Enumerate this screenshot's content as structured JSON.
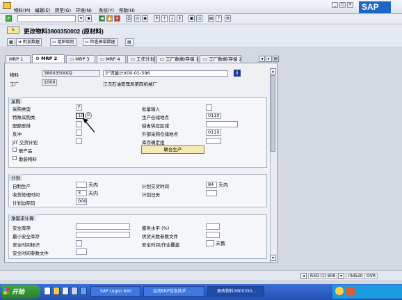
{
  "menu": {
    "items": [
      "物料(M)",
      "编辑(E)",
      "转至(G)",
      "环境(N)",
      "系统(Y)",
      "帮助(H)"
    ],
    "logo": "SAP"
  },
  "toolbar": {
    "command_value": ""
  },
  "title": "更改物料3800350002 (原材料)",
  "app_toolbar": {
    "additional_data": "附加数据",
    "org_levels": "组织级别",
    "check_screen_data": "检查屏幕数据"
  },
  "tabs": [
    "MRP 1",
    "MRP 2",
    "MRP 3",
    "MRP 4",
    "工作计划",
    "工厂数据/存储 1",
    "工厂数据/存储 2"
  ],
  "header": {
    "material_label": "物料",
    "material_value": "3800350002",
    "material_desc": "3\"流量计X00-01-596",
    "plant_label": "工厂",
    "plant_value": "1000",
    "plant_desc": "江汉石油管理局第四机械厂"
  },
  "procurement": {
    "title": "采购",
    "proc_type_label": "采购类型",
    "proc_type_value": "F",
    "special_proc_label": "特殊采购类",
    "special_proc_value": "10",
    "qt_label": "配额安排",
    "backflush_label": "反冲",
    "jit_label": "JIT 交货计划",
    "coproduct_label": "联产品",
    "bulk_label": "散装物料",
    "batch_entry_label": "批量输入",
    "prod_stor_label": "生产仓储地点",
    "prod_stor_value": "0110",
    "default_supply_label": "缺省供应区域",
    "ext_proc_stor_label": "外部采购仓储地点",
    "ext_proc_stor_value": "0110",
    "stor_bin_label": "库存确定组",
    "joint_prod_button": "联合生产"
  },
  "scheduling": {
    "title": "计划",
    "inhouse_label": "自制生产",
    "inhouse_unit": "天内",
    "gr_time_label": "收货处理时间",
    "gr_time_value": "3",
    "gr_time_unit": "天内",
    "sm_key_label": "计划边际码",
    "sm_key_value": "000",
    "pdt_label": "计划交货时间",
    "pdt_value": "84",
    "pdt_unit": "天内",
    "calendar_label": "计划日历"
  },
  "net_req": {
    "title": "净需求计算",
    "safety_stock_label": "安全库存",
    "min_safety_label": "最小安全库存",
    "safety_time_ind_label": "安全时间标识",
    "safety_time_profile_label": "安全时间参数文件",
    "service_level_label": "服务水平 (%)",
    "coverage_profile_label": "供货天数参数文件",
    "safety_time_label": "安全时间/作业覆盖",
    "safety_time_unit": "天数"
  },
  "status": {
    "system": "R3D (1) 600",
    "server": "r3d520",
    "mode": "OVR"
  },
  "taskbar": {
    "start": "开始",
    "tasks": [
      "SAP Logon 640",
      "运用ERP信息技术 ...",
      "更改物料3800350..."
    ]
  }
}
